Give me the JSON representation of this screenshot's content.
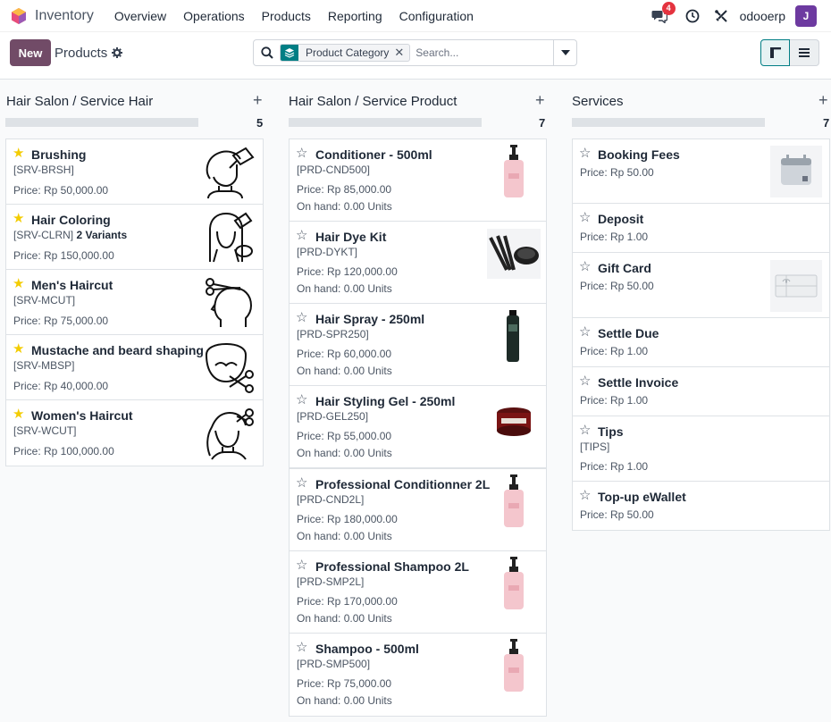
{
  "navbar": {
    "app_name": "Inventory",
    "menu": [
      "Overview",
      "Operations",
      "Products",
      "Reporting",
      "Configuration"
    ],
    "message_count": "4",
    "company": "odooerp",
    "user_initial": "J"
  },
  "control": {
    "new_label": "New",
    "title": "Products",
    "facet_label": "Product Category",
    "search_placeholder": "Search..."
  },
  "columns": [
    {
      "title": "Hair Salon / Service Hair",
      "count": "5",
      "cards": [
        {
          "name": "Brushing",
          "ref": "[SRV-BRSH]",
          "price": "Price: Rp 50,000.00",
          "icon": "brushing-icon"
        },
        {
          "name": "Hair Coloring",
          "ref": "[SRV-CLRN]",
          "variants": "2 Variants",
          "price": "Price: Rp 150,000.00",
          "icon": "hair-coloring-icon"
        },
        {
          "name": "Men's Haircut",
          "ref": "[SRV-MCUT]",
          "price": "Price: Rp 75,000.00",
          "icon": "mens-haircut-icon"
        },
        {
          "name": "Mustache and beard shaping",
          "ref": "[SRV-MBSP]",
          "price": "Price: Rp 40,000.00",
          "icon": "beard-shaping-icon"
        },
        {
          "name": "Women's Haircut",
          "ref": "[SRV-WCUT]",
          "price": "Price: Rp 100,000.00",
          "icon": "womens-haircut-icon"
        }
      ]
    },
    {
      "title": "Hair Salon / Service Product",
      "count": "7",
      "cards": [
        {
          "name": "Conditioner - 500ml",
          "ref": "[PRD-CND500]",
          "price": "Price: Rp 85,000.00",
          "onhand": "On hand: 0.00 Units",
          "icon": "pump-bottle-image"
        },
        {
          "name": "Hair Dye Kit",
          "ref": "[PRD-DYKT]",
          "price": "Price: Rp 120,000.00",
          "onhand": "On hand: 0.00 Units",
          "icon": "dye-kit-image"
        },
        {
          "name": "Hair Spray - 250ml",
          "ref": "[PRD-SPR250]",
          "price": "Price: Rp 60,000.00",
          "onhand": "On hand: 0.00 Units",
          "icon": "spray-can-image"
        },
        {
          "name": "Hair Styling Gel - 250ml",
          "ref": "[PRD-GEL250]",
          "price": "Price: Rp 55,000.00",
          "onhand": "On hand: 0.00 Units",
          "icon": "gel-jar-image"
        },
        {
          "name": "Professional Conditionner 2L",
          "ref": "[PRD-CND2L]",
          "price": "Price: Rp 180,000.00",
          "onhand": "On hand: 0.00 Units",
          "icon": "pump-bottle-image"
        },
        {
          "name": "Professional Shampoo 2L",
          "ref": "[PRD-SMP2L]",
          "price": "Price: Rp 170,000.00",
          "onhand": "On hand: 0.00 Units",
          "icon": "pump-bottle-image"
        },
        {
          "name": "Shampoo - 500ml",
          "ref": "[PRD-SMP500]",
          "price": "Price: Rp 75,000.00",
          "onhand": "On hand: 0.00 Units",
          "icon": "pump-bottle-image"
        }
      ]
    },
    {
      "title": "Services",
      "count": "7",
      "cards": [
        {
          "name": "Booking Fees",
          "price": "Price: Rp 50.00",
          "icon": "calendar-icon"
        },
        {
          "name": "Deposit",
          "price": "Price: Rp 1.00"
        },
        {
          "name": "Gift Card",
          "price": "Price: Rp 50.00",
          "icon": "gift-card-icon"
        },
        {
          "name": "Settle Due",
          "price": "Price: Rp 1.00"
        },
        {
          "name": "Settle Invoice",
          "price": "Price: Rp 1.00"
        },
        {
          "name": "Tips",
          "ref": "[TIPS]",
          "price": "Price: Rp 1.00"
        },
        {
          "name": "Top-up eWallet",
          "price": "Price: Rp 50.00"
        }
      ]
    }
  ]
}
